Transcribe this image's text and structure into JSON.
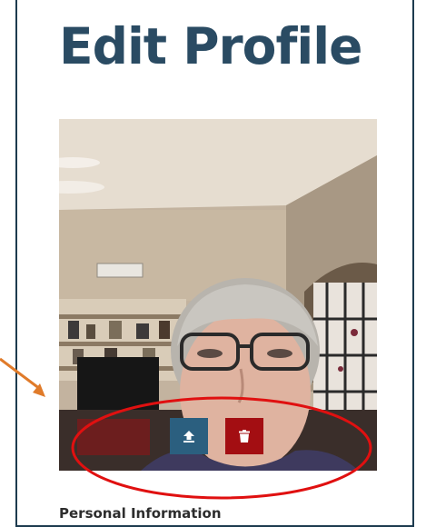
{
  "page": {
    "title": "Edit Profile",
    "section_heading": "Personal Information"
  },
  "profile_photo": {
    "upload_icon": "upload-icon",
    "delete_icon": "trash-icon"
  },
  "annotation": {
    "arrow_color": "#e07b2a",
    "ellipse_color": "#e01010"
  },
  "colors": {
    "title": "#2a4b63",
    "upload_button": "#2b5f7f",
    "delete_button": "#a30e12",
    "panel_border": "#1d3b4f"
  }
}
